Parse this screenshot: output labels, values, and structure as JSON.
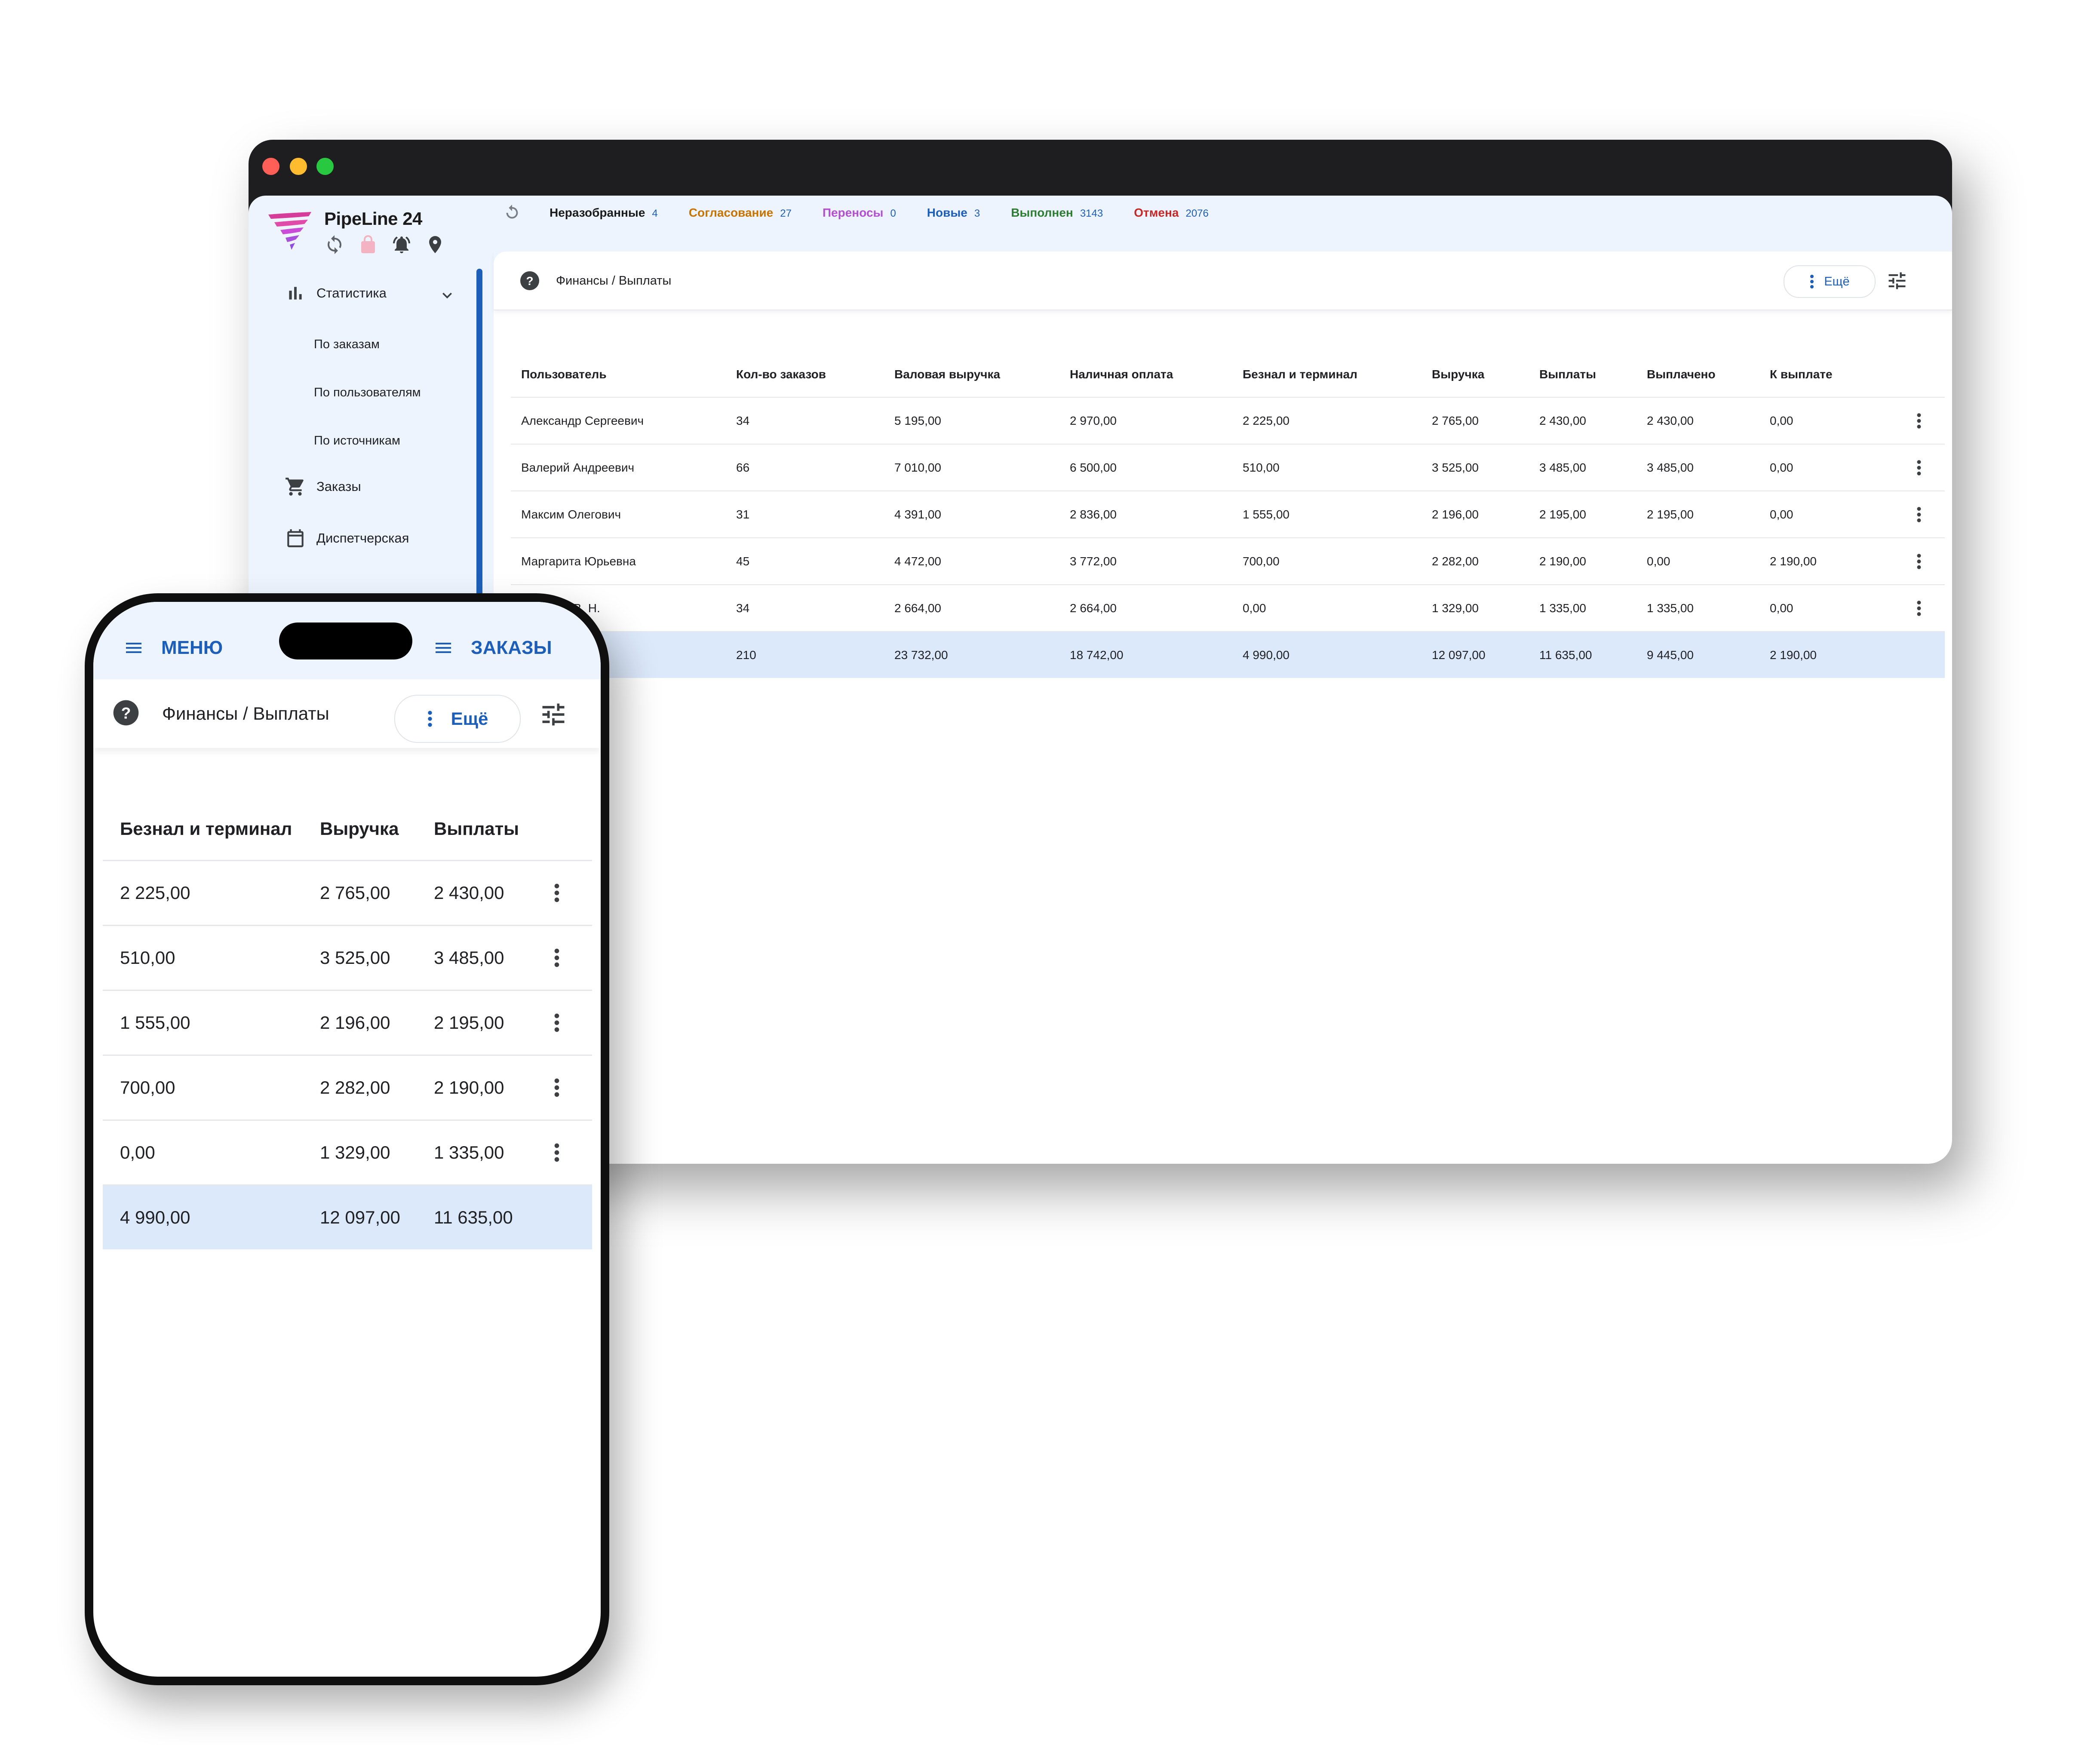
{
  "desktop": {
    "app_name": "PipeLine 24",
    "header_icons": [
      "sync-icon",
      "lock-icon",
      "alarm-icon",
      "location-icon"
    ],
    "status_tabs": [
      {
        "label": "Неразобранные",
        "count": "4",
        "color": "#1b1b1b",
        "count_color": "#1d5fb8"
      },
      {
        "label": "Согласование",
        "count": "27",
        "color": "#c77400",
        "count_color": "#1d5fb8"
      },
      {
        "label": "Переносы",
        "count": "0",
        "color": "#b34fd1",
        "count_color": "#1d5fb8"
      },
      {
        "label": "Новые",
        "count": "3",
        "color": "#1d5fb8",
        "count_color": "#1d5fb8"
      },
      {
        "label": "Выполнен",
        "count": "3143",
        "color": "#2e7d32",
        "count_color": "#1d5fb8"
      },
      {
        "label": "Отмена",
        "count": "2076",
        "color": "#c62828",
        "count_color": "#1d5fb8"
      }
    ],
    "sidebar": {
      "statistics": "Статистика",
      "sub_items": [
        "По заказам",
        "По пользователям",
        "По источникам"
      ],
      "orders": "Заказы",
      "dispatch": "Диспетчерская"
    },
    "breadcrumb": "Финансы / Выплаты",
    "more_label": "Ещё",
    "table": {
      "columns": [
        "Пользователь",
        "Кол-во заказов",
        "Валовая выручка",
        "Наличная оплата",
        "Безнал и терминал",
        "Выручка",
        "Выплаты",
        "Выплачено",
        "К выплате"
      ],
      "rows": [
        [
          "Александр Сергеевич",
          "34",
          "5 195,00",
          "2 970,00",
          "2 225,00",
          "2 765,00",
          "2 430,00",
          "2 430,00",
          "0,00"
        ],
        [
          "Валерий Андреевич",
          "66",
          "7 010,00",
          "6 500,00",
          "510,00",
          "3 525,00",
          "3 485,00",
          "3 485,00",
          "0,00"
        ],
        [
          "Максим Олегович",
          "31",
          "4 391,00",
          "2 836,00",
          "1 555,00",
          "2 196,00",
          "2 195,00",
          "2 195,00",
          "0,00"
        ],
        [
          "Маргарита Юрьевна",
          "45",
          "4 472,00",
          "3 772,00",
          "700,00",
          "2 282,00",
          "2 190,00",
          "0,00",
          "2 190,00"
        ],
        [
          "Сидоров В. Н.",
          "34",
          "2 664,00",
          "2 664,00",
          "0,00",
          "1 329,00",
          "1 335,00",
          "1 335,00",
          "0,00"
        ]
      ],
      "total": [
        "",
        "210",
        "23 732,00",
        "18 742,00",
        "4 990,00",
        "12 097,00",
        "11 635,00",
        "9 445,00",
        "2 190,00"
      ]
    }
  },
  "phone": {
    "menu_label": "МЕНЮ",
    "orders_label": "ЗАКАЗЫ",
    "breadcrumb": "Финансы / Выплаты",
    "more_label": "Ещё",
    "table": {
      "columns": [
        "Безнал и терминал",
        "Выручка",
        "Выплаты"
      ],
      "rows": [
        [
          "2 225,00",
          "2 765,00",
          "2 430,00"
        ],
        [
          "510,00",
          "3 525,00",
          "3 485,00"
        ],
        [
          "1 555,00",
          "2 196,00",
          "2 195,00"
        ],
        [
          "700,00",
          "2 282,00",
          "2 190,00"
        ],
        [
          "0,00",
          "1 329,00",
          "1 335,00"
        ]
      ],
      "total": [
        "4 990,00",
        "12 097,00",
        "11 635,00"
      ]
    }
  },
  "colors": {
    "accent": "#1d5fb8",
    "app_background": "#eef4fd",
    "total_row": "#dce9fb",
    "logo_pink": "#d63d9b"
  }
}
